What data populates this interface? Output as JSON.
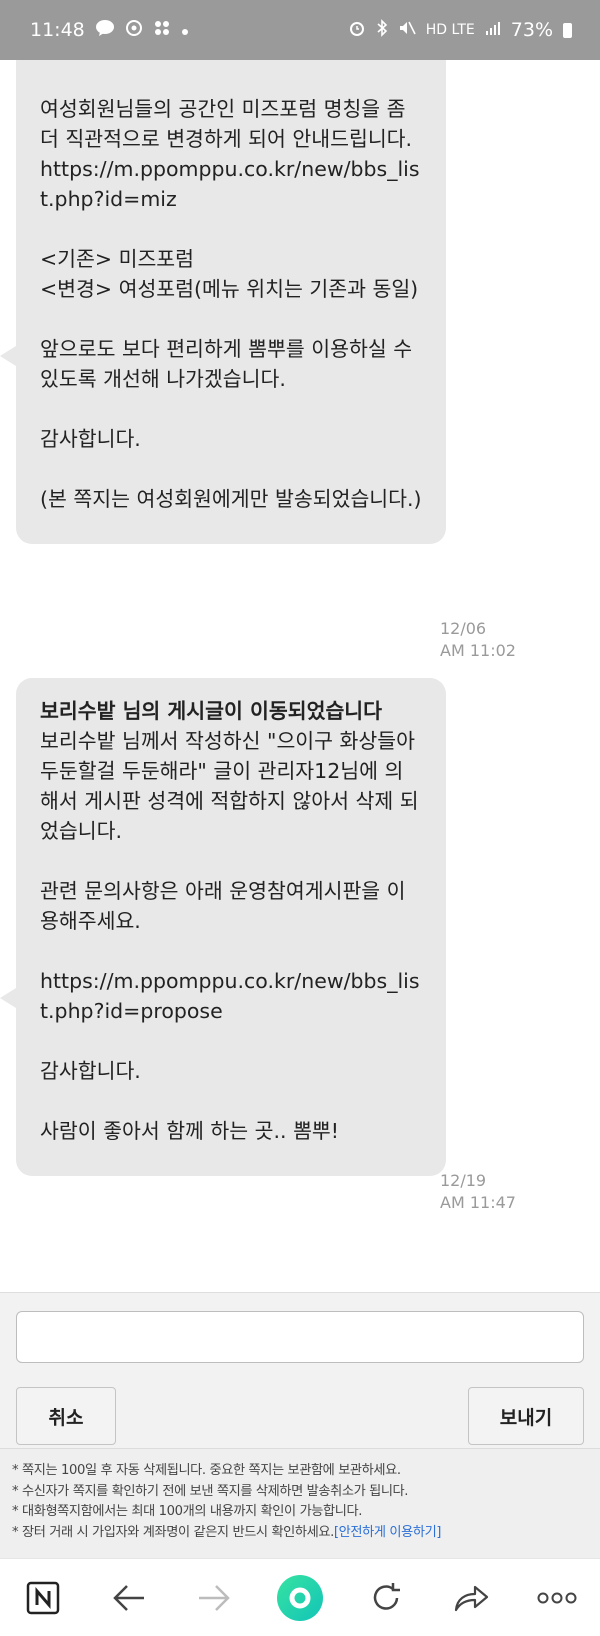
{
  "status_bar": {
    "time": "11:48",
    "indicators": "HD LTE",
    "battery": "73%"
  },
  "messages": [
    {
      "title": "",
      "body": "\n여성회원님들의 공간인 미즈포럼 명칭을 좀 더 직관적으로 변경하게 되어 안내드립니다.\nhttps://m.ppomppu.co.kr/new/bbs_list.php?id=miz\n\n<기존> 미즈포럼\n<변경> 여성포럼(메뉴 위치는 기존과 동일)\n\n앞으로도 보다 편리하게 뽐뿌를 이용하실 수 있도록 개선해 나가겠습니다.\n\n감사합니다.\n\n(본 쪽지는 여성회원에게만 발송되었습니다.)",
      "time": "12/06\nAM 11:02"
    },
    {
      "title": "보리수밭 님의 게시글이 이동되었습니다",
      "body": "보리수밭 님께서 작성하신 \"으이구 화상들아 두둔할걸 두둔해라\" 글이 관리자12님에 의해서 게시판 성격에 적합하지 않아서 삭제 되었습니다.\n\n관련 문의사항은 아래 운영참여게시판을 이용해주세요.\n\nhttps://m.ppomppu.co.kr/new/bbs_list.php?id=propose\n\n감사합니다.\n\n사람이 좋아서 함께 하는 곳.. 뽐뿌!",
      "time": "12/19\nAM 11:47"
    }
  ],
  "compose": {
    "placeholder": "",
    "cancel_label": "취소",
    "send_label": "보내기"
  },
  "notes": {
    "line1": "* 쪽지는 100일 후 자동 삭제됩니다. 중요한 쪽지는 보관함에 보관하세요.",
    "line2": "* 수신자가 쪽지를 확인하기 전에 보낸 쪽지를 삭제하면 발송취소가 됩니다.",
    "line3": "* 대화형쪽지함에서는 최대 100개의 내용까지 확인이 가능합니다.",
    "line4": "* 장터 거래 시 가입자와 계좌명이 같은지 반드시 확인하세요.",
    "line4_link": "[안전하게 이용하기]"
  },
  "colors": {
    "bubble": "#e8e8e8",
    "link": "#2b6fd6",
    "green_button": "#1ed5a6",
    "status_bar": "#9a9a9a"
  },
  "nav_icons": [
    "naver-n-icon",
    "back-arrow-icon",
    "forward-arrow-icon",
    "green-home-icon",
    "refresh-icon",
    "share-icon",
    "more-dots-icon"
  ]
}
